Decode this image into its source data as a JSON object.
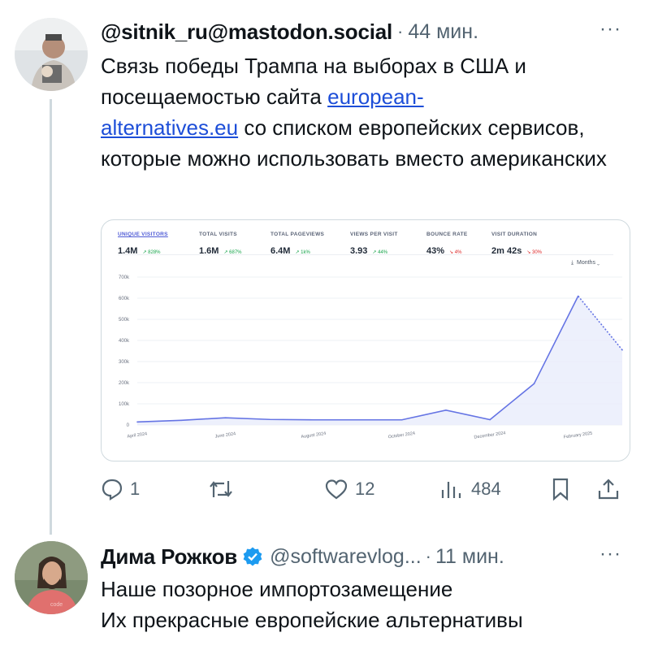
{
  "post": {
    "handle": "@sitnik_ru@mastodon.social",
    "separator": "·",
    "time": "44 мин.",
    "more": "···",
    "text_before": "Связь победы Трампа на выборах в США и посещаемостью сайта ",
    "link_line1": "european-",
    "link_line2": "alternatives.eu",
    "text_after": " со списком европейских сервисов, которые можно использовать вместо американских",
    "actions": {
      "replies": "1",
      "reposts": "",
      "likes": "12",
      "views": "484"
    }
  },
  "analytics": {
    "stats": [
      {
        "label": "UNIQUE VISITORS",
        "value": "1.4M",
        "change": "↗ 828%",
        "direction": "up",
        "active": true
      },
      {
        "label": "TOTAL VISITS",
        "value": "1.6M",
        "change": "↗ 687%",
        "direction": "up",
        "active": false
      },
      {
        "label": "TOTAL PAGEVIEWS",
        "value": "6.4M",
        "change": "↗ 1k%",
        "direction": "up",
        "active": false
      },
      {
        "label": "VIEWS PER VISIT",
        "value": "3.93",
        "change": "↗ 44%",
        "direction": "up",
        "active": false
      },
      {
        "label": "BOUNCE RATE",
        "value": "43%",
        "change": "↘ 4%",
        "direction": "down",
        "active": false
      },
      {
        "label": "VISIT DURATION",
        "value": "2m 42s",
        "change": "↘ 30%",
        "direction": "down",
        "active": false
      }
    ],
    "period_selector": "Months",
    "period_icon": "download-icon"
  },
  "chart_data": {
    "type": "line",
    "x": [
      "April 2024",
      "May 2024",
      "June 2024",
      "July 2024",
      "August 2024",
      "September 2024",
      "October 2024",
      "November 2024",
      "December 2024",
      "January 2025",
      "February 2025",
      "March 2025"
    ],
    "x_tick_labels": [
      "April 2024",
      "June 2024",
      "August 2024",
      "October 2024",
      "December 2024",
      "February 2025"
    ],
    "series": [
      {
        "values": [
          14000,
          22000,
          34000,
          26000,
          24000,
          24000,
          24000,
          70000,
          25000,
          195000,
          610000,
          355000
        ]
      }
    ],
    "y_ticks": [
      "0",
      "100k",
      "200k",
      "300k",
      "400k",
      "500k",
      "600k",
      "700k"
    ],
    "ylim": [
      0,
      700000
    ],
    "last_segment_dashed": true,
    "grid": true,
    "line_color": "#6574e4",
    "fill_color": "#e9ecfb"
  },
  "reply": {
    "name": "Дима Рожков",
    "handle": "@softwarevlog...",
    "separator": "·",
    "time": "11 мин.",
    "more": "···",
    "line1": "Наше позорное импортозамещение",
    "line2": "Их прекрасные европейские альтернативы"
  },
  "colors": {
    "verified": "#1d9bf0",
    "link": "#1d4ed8",
    "muted": "#536471"
  }
}
